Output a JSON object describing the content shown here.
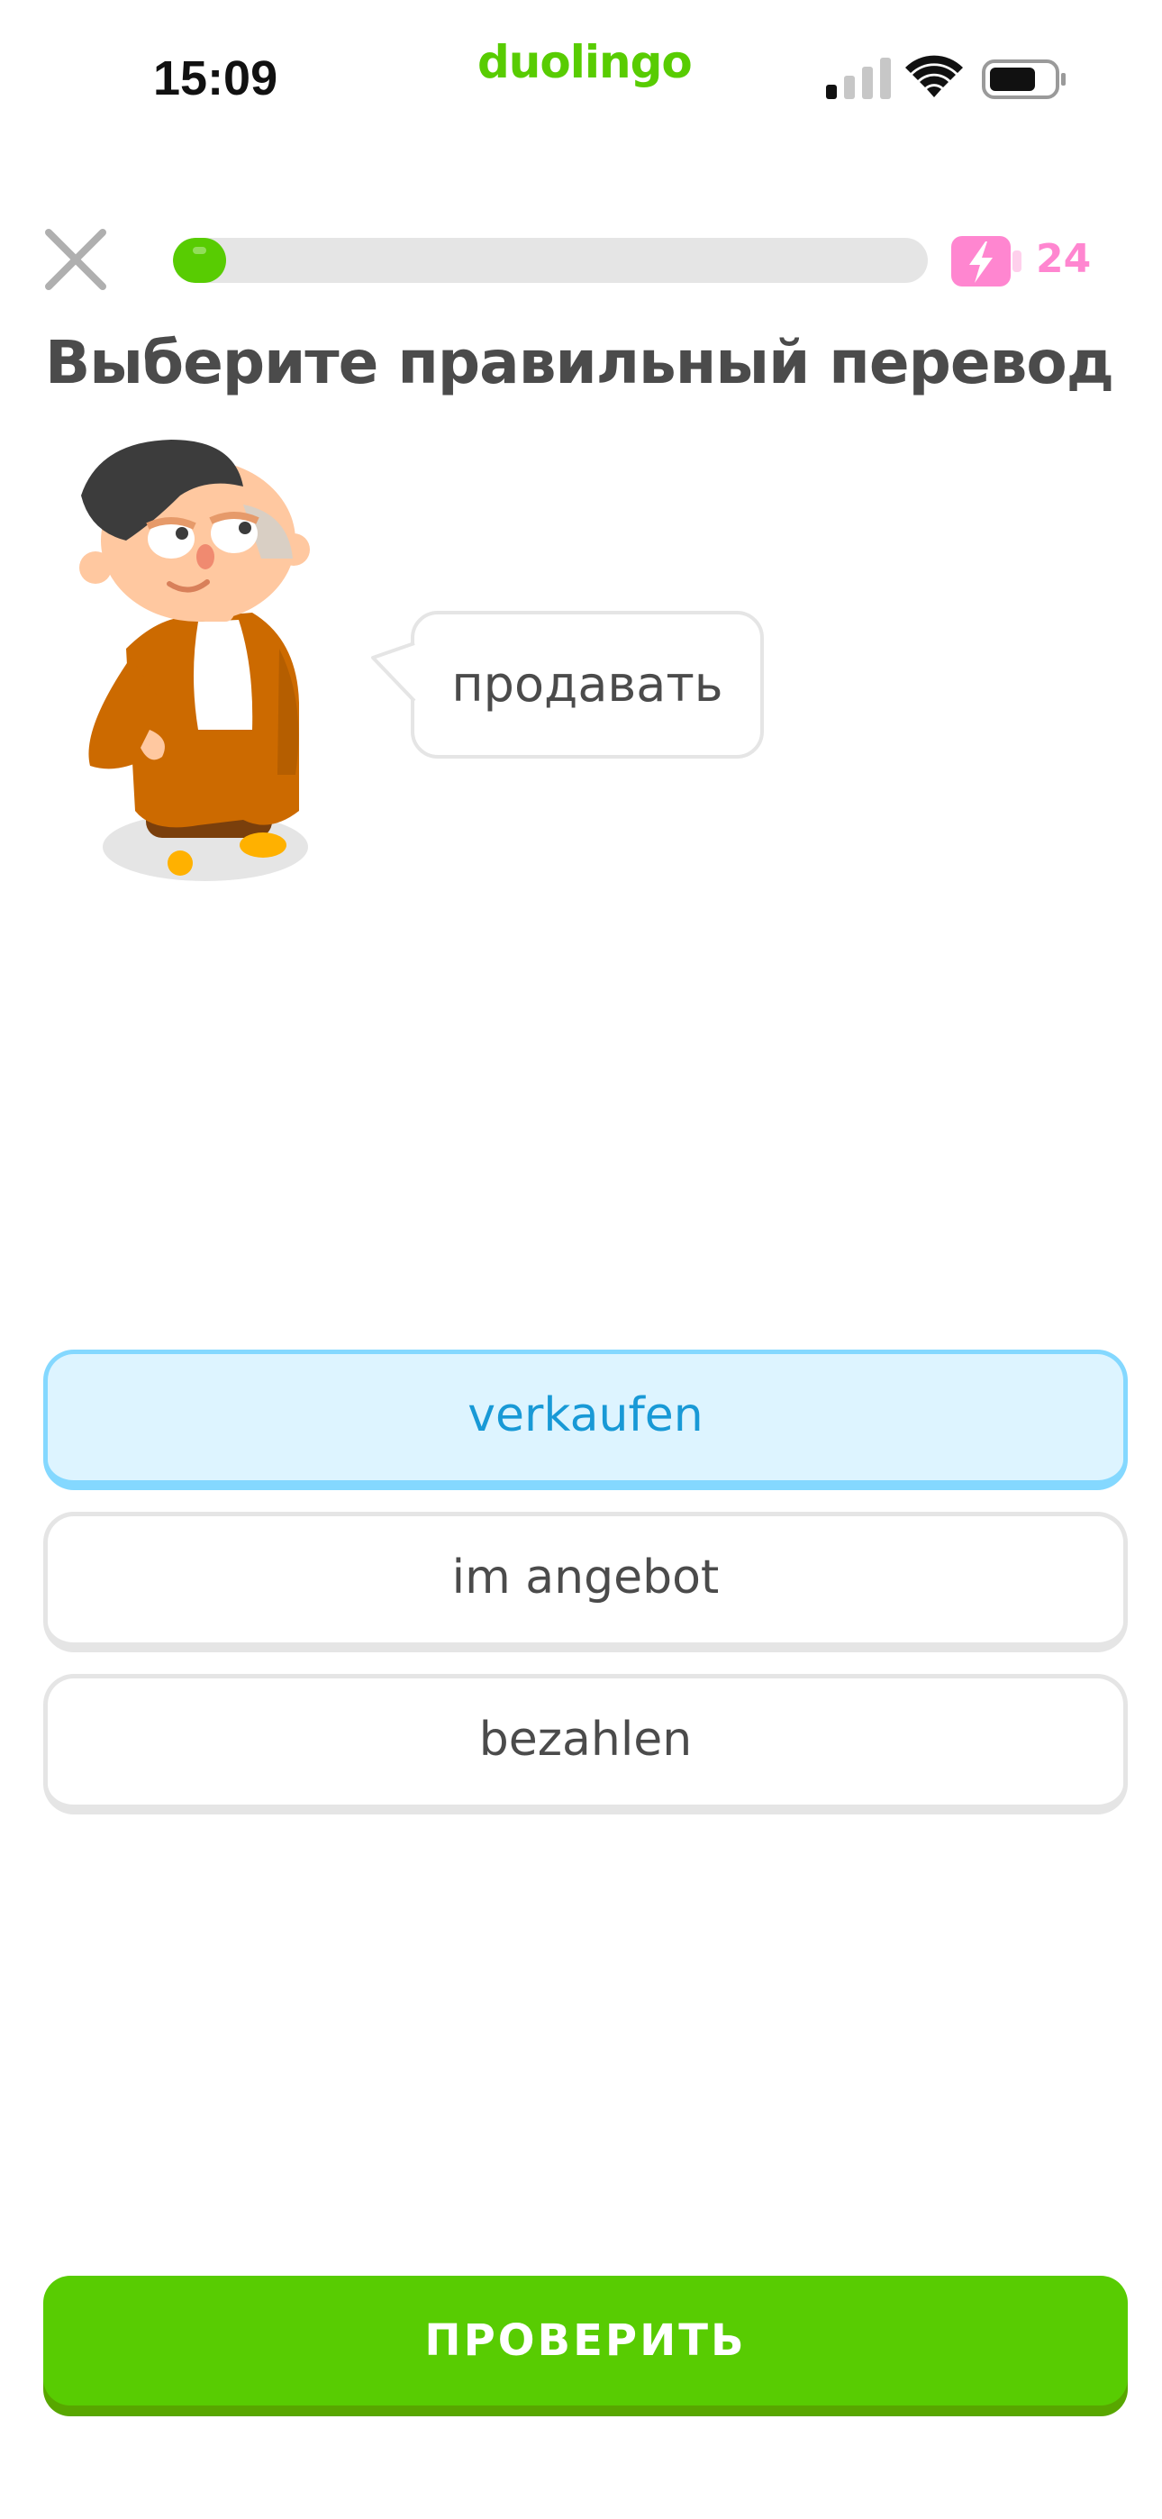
{
  "status_bar": {
    "time": "15:09",
    "brand": "duolingo",
    "icons": [
      "cellular-signal-icon",
      "wifi-icon",
      "battery-icon"
    ]
  },
  "top_bar": {
    "close_icon": "close-icon",
    "progress_fraction": 0.07,
    "energy_icon": "energy-battery-icon",
    "energy_count": "24"
  },
  "prompt": {
    "title": "Выберите правильный перевод",
    "speech_text": "продавать"
  },
  "options": [
    {
      "label": "verkaufen",
      "selected": true
    },
    {
      "label": "im angebot",
      "selected": false
    },
    {
      "label": "bezahlen",
      "selected": false
    }
  ],
  "check_button": {
    "label": "ПРОВЕРИТЬ"
  },
  "colors": {
    "brand_green": "#58cc02",
    "brand_green_dark": "#58a700",
    "selected_bg": "#ddf4ff",
    "selected_border": "#84d8ff",
    "selected_text": "#1899d6",
    "energy_pink": "#ff86d0",
    "text_gray": "#4b4b4b"
  }
}
